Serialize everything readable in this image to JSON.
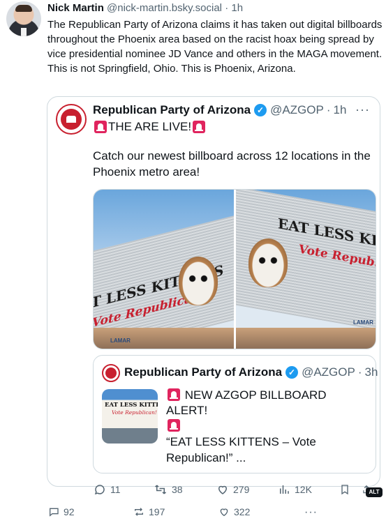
{
  "outer_post": {
    "author_name": "Nick Martin",
    "handle": "@nick-martin.bsky.social",
    "separator": "·",
    "time": "1h",
    "text": "The Republican Party of Arizona claims it has taken out digital billboards throughout the Phoenix area based on the racist hoax being spread by vice presidential nominee JD Vance and others in the MAGA movement. This is not Springfield, Ohio. This is Phoenix, Arizona."
  },
  "embedded_post": {
    "author_name": "Republican Party of Arizona",
    "verified_icon": "verified-badge-icon",
    "handle": "@AZGOP",
    "separator": "·",
    "time": "1h",
    "more_label": "···",
    "title": "THE ARE LIVE!",
    "body": "Catch our newest billboard across 12 locations in the Phoenix metro area!",
    "media": {
      "left": {
        "line1": "T LESS KITTENS",
        "line2": "Vote Republican!",
        "sign": "LAMAR"
      },
      "right": {
        "line1": "EAT LESS KIT",
        "line2": "Vote Republi",
        "sign": "LAMAR"
      }
    },
    "quote": {
      "author_name": "Republican Party of Arizona",
      "handle": "@AZGOP",
      "separator": "·",
      "time": "3h",
      "title": "NEW AZGOP BILLBOARD ALERT!",
      "body": "“EAT LESS KITTENS – Vote Republican!” ...",
      "thumb_line1": "EAT LESS KITTENS",
      "thumb_line2": "Vote Republican!"
    },
    "actions": {
      "replies": "11",
      "reposts": "38",
      "likes": "279",
      "views": "12K",
      "alt_label": "ALT"
    }
  },
  "outer_actions": {
    "replies": "92",
    "reposts": "197",
    "likes": "322",
    "more_label": "···"
  },
  "colors": {
    "accent_red": "#c8202f",
    "verified_blue": "#1d9bf0",
    "muted_text": "#536471",
    "border": "#cfd9de"
  }
}
